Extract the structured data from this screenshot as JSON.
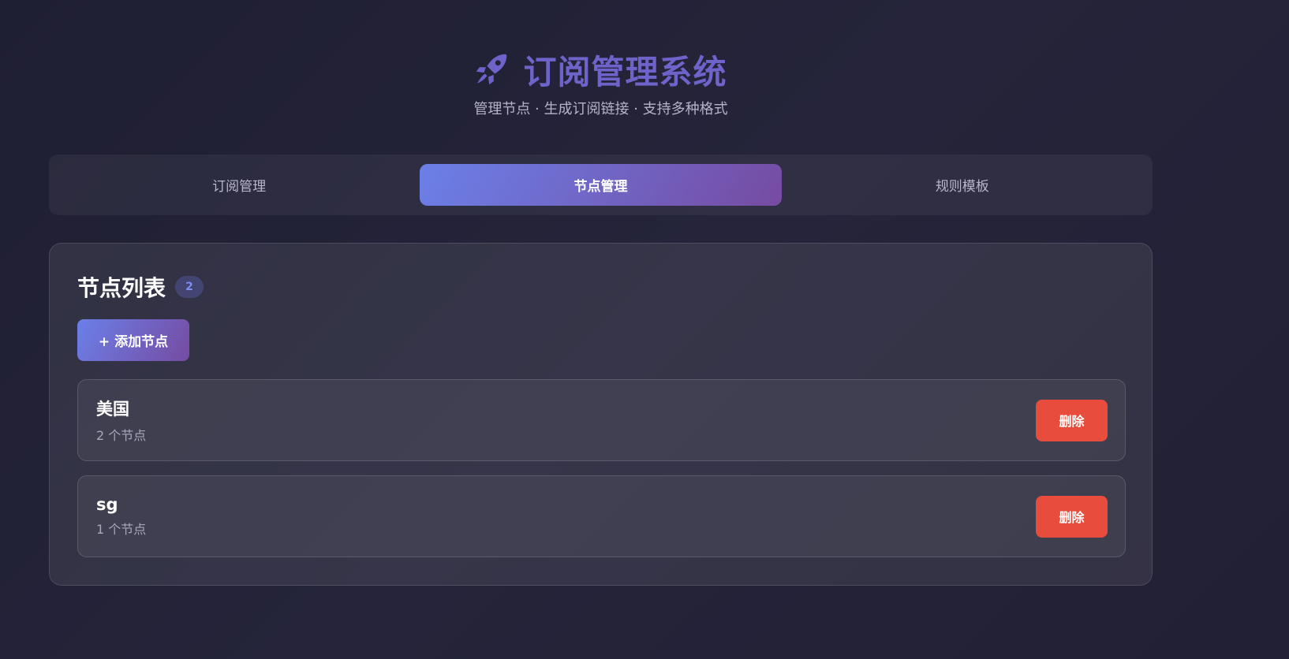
{
  "header": {
    "icon": "rocket-icon",
    "title": "订阅管理系统",
    "subtitle": "管理节点 · 生成订阅链接 · 支持多种格式"
  },
  "tabs": [
    {
      "label": "订阅管理",
      "active": false
    },
    {
      "label": "节点管理",
      "active": true
    },
    {
      "label": "规则模板",
      "active": false
    }
  ],
  "node_panel": {
    "title": "节点列表",
    "count": "2",
    "add_label": "+ 添加节点",
    "items": [
      {
        "name": "美国",
        "count_text": "2 个节点",
        "delete_label": "删除"
      },
      {
        "name": "sg",
        "count_text": "1 个节点",
        "delete_label": "删除"
      }
    ]
  },
  "colors": {
    "accent_start": "#6b80e8",
    "accent_end": "#764ba2",
    "danger": "#e74c3c",
    "title": "#6d63c9"
  }
}
